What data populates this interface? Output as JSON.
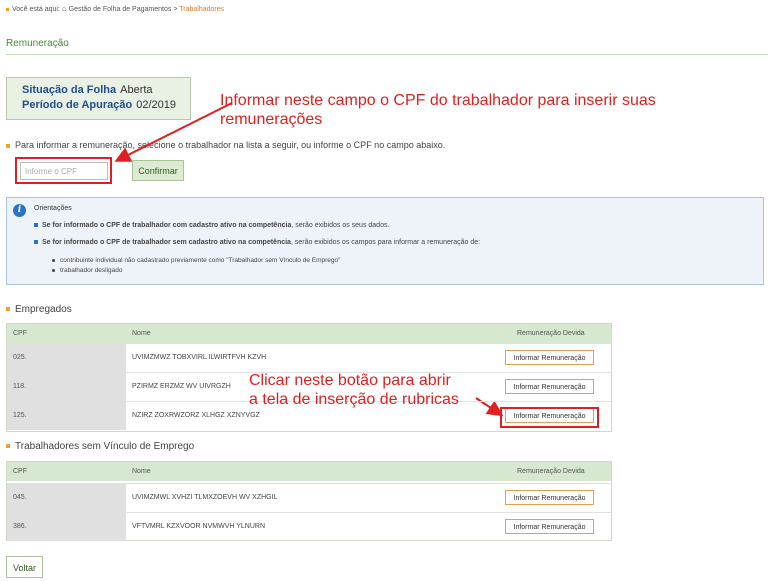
{
  "breadcrumb": {
    "prefix": "Você está aqui:",
    "home_icon": "home-icon",
    "level1": "Gestão de Folha de Pagamentos",
    "separator": ">",
    "current": "Trabalhadores"
  },
  "section_title": "Remuneração",
  "status": {
    "situacao_label": "Situação da Folha",
    "situacao_value": "Aberta",
    "periodo_label": "Período de Apuração",
    "periodo_value": "02/2019"
  },
  "annotations": {
    "cpf_line1": "Informar neste campo o CPF do trabalhador para inserir suas",
    "cpf_line2": "remunerações",
    "button_line1": "Clicar neste botão para abrir",
    "button_line2": "a tela de inserção de rubricas"
  },
  "instruction": "Para informar a remuneração, selecione o trabalhador na lista a seguir, ou informe o CPF no campo abaixo.",
  "cpf_field": {
    "placeholder": "Informe o CPF",
    "value": ""
  },
  "confirm_label": "Confirmar",
  "orientacoes": {
    "title": "Orientações",
    "item1_bold": "Se for informado o CPF de trabalhador com cadastro ativo na competência",
    "item1_rest": ", serão exibidos os seus dados.",
    "item2_bold": "Se for informado o CPF de trabalhador sem cadastro ativo na competência",
    "item2_rest": ", serão exibidos os campos para informar a remuneração de:",
    "sub1": "contribuinte individual não cadastrado previamente como \"Trabalhador sem Vínculo de Emprego\"",
    "sub2": "trabalhador desligado"
  },
  "empregados": {
    "title": "Empregados",
    "headers": {
      "cpf": "CPF",
      "nome": "Nome",
      "rem": "Remuneração Devida"
    },
    "rows": [
      {
        "cpf": "025.",
        "nome": "UVIMZMWZ TOBXVIRL ILWIRTFVH KZVH",
        "action": "Informar Remuneração"
      },
      {
        "cpf": "118.",
        "nome": "PZIRMZ ERZMZ WV UIVRGZH",
        "action": "Informar Remuneração"
      },
      {
        "cpf": "125.",
        "nome": "NZIRZ ZOXRWZORZ XLHGZ XZNYVGZ",
        "action": "Informar Remuneração"
      }
    ]
  },
  "sem_vinculo": {
    "title": "Trabalhadores sem Vínculo de Emprego",
    "headers": {
      "cpf": "CPF",
      "nome": "Nome",
      "rem": "Remuneração Devida"
    },
    "rows": [
      {
        "cpf": "045.",
        "nome": "UVIMZMWL XVHZI TLMXZOEVH WV XZHGIL",
        "action": "Informar Remuneração"
      },
      {
        "cpf": "386.",
        "nome": "VFTVMRL KZXVOOR NVMWVH YLNURN",
        "action": "Informar Remuneração"
      }
    ]
  },
  "back_label": "Voltar",
  "colors": {
    "annotation_red": "#e02020",
    "accent_green": "#4a8a3a",
    "orange": "#f0a030"
  }
}
